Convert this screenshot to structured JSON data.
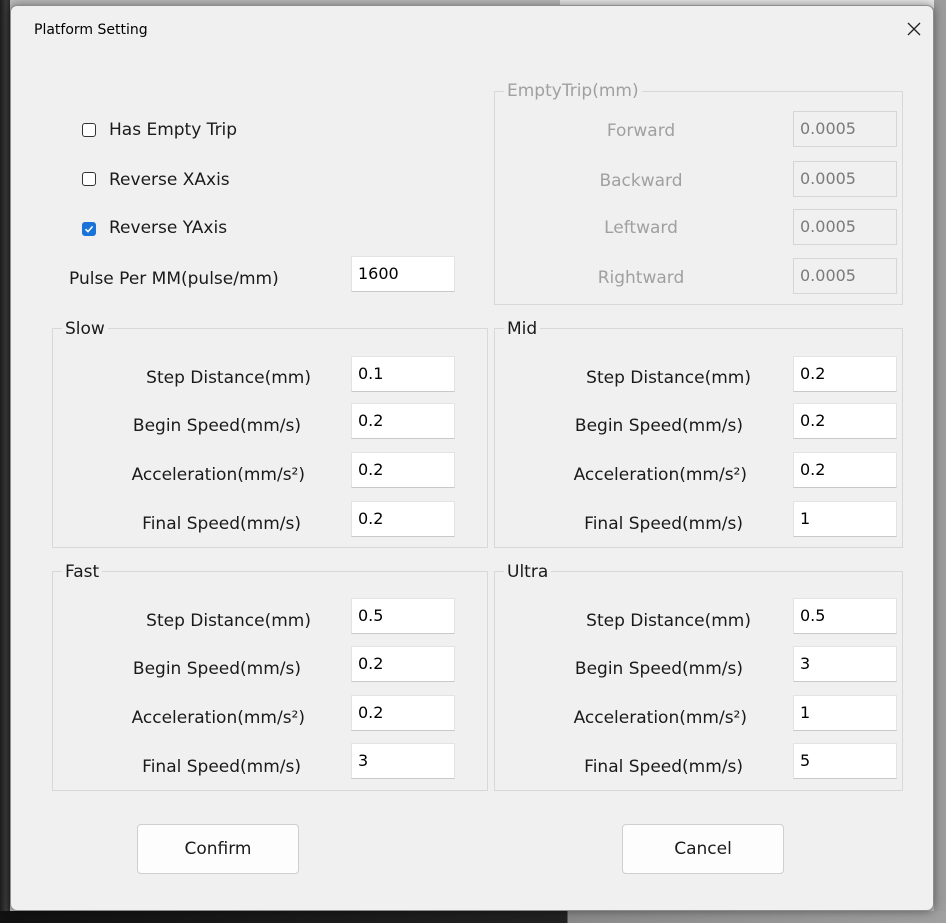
{
  "window": {
    "title": "Platform Setting",
    "close_icon": "close-icon"
  },
  "options": {
    "has_empty_trip": {
      "label": "Has Empty Trip",
      "checked": false
    },
    "reverse_xaxis": {
      "label": "Reverse XAxis",
      "checked": false
    },
    "reverse_yaxis": {
      "label": "Reverse YAxis",
      "checked": true
    },
    "pulse_per_mm": {
      "label": "Pulse Per MM(pulse/mm)",
      "value": "1600"
    }
  },
  "empty_trip": {
    "title": "EmptyTrip(mm)",
    "forward": {
      "label": "Forward",
      "value": "0.0005"
    },
    "backward": {
      "label": "Backward",
      "value": "0.0005"
    },
    "leftward": {
      "label": "Leftward",
      "value": "0.0005"
    },
    "rightward": {
      "label": "Rightward",
      "value": "0.0005"
    }
  },
  "slow": {
    "title": "Slow",
    "step_label": "Step Distance(mm)",
    "step_value": "0.1",
    "begin_label": "Begin Speed(mm/s)",
    "begin_value": "0.2",
    "accel_label": "Acceleration(mm/s²)",
    "accel_value": "0.2",
    "final_label": "Final Speed(mm/s)",
    "final_value": "0.2"
  },
  "mid": {
    "title": "Mid",
    "step_label": "Step Distance(mm)",
    "step_value": "0.2",
    "begin_label": "Begin Speed(mm/s)",
    "begin_value": "0.2",
    "accel_label": "Acceleration(mm/s²)",
    "accel_value": "0.2",
    "final_label": "Final Speed(mm/s)",
    "final_value": "1"
  },
  "fast": {
    "title": "Fast",
    "step_label": "Step Distance(mm)",
    "step_value": "0.5",
    "begin_label": "Begin Speed(mm/s)",
    "begin_value": "0.2",
    "accel_label": "Acceleration(mm/s²)",
    "accel_value": "0.2",
    "final_label": "Final Speed(mm/s)",
    "final_value": "3"
  },
  "ultra": {
    "title": "Ultra",
    "step_label": "Step Distance(mm)",
    "step_value": "0.5",
    "begin_label": "Begin Speed(mm/s)",
    "begin_value": "3",
    "accel_label": "Acceleration(mm/s²)",
    "accel_value": "1",
    "final_label": "Final Speed(mm/s)",
    "final_value": "5"
  },
  "buttons": {
    "confirm": "Confirm",
    "cancel": "Cancel"
  },
  "colors": {
    "checkbox_accent": "#1a73d8",
    "dialog_bg": "#f0f0f0",
    "disabled_text": "#a0a0a0"
  }
}
